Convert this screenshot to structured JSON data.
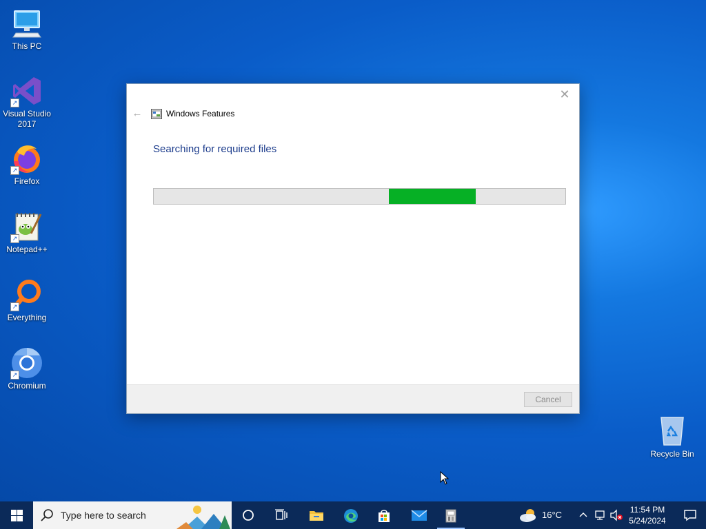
{
  "desktop": {
    "icons": [
      {
        "label": "This PC",
        "icon": "computer-icon"
      },
      {
        "label": "Visual Studio 2017",
        "icon": "visual-studio-icon"
      },
      {
        "label": "Firefox",
        "icon": "firefox-icon"
      },
      {
        "label": "Notepad++",
        "icon": "notepadpp-icon"
      },
      {
        "label": "Everything",
        "icon": "everything-search-icon"
      },
      {
        "label": "Chromium",
        "icon": "chromium-icon"
      },
      {
        "label": "Recycle Bin",
        "icon": "recycle-bin-icon"
      }
    ]
  },
  "dialog": {
    "title": "Windows Features",
    "heading": "Searching for required files",
    "progress": {
      "start_fraction": 0.571,
      "end_fraction": 0.783,
      "color": "#06b025"
    },
    "cancel_label": "Cancel",
    "close_icon": "close-icon",
    "back_icon": "back-arrow-icon"
  },
  "taskbar": {
    "search_placeholder": "Type here to search",
    "pinned": [
      "cortana-icon",
      "task-view-icon",
      "file-explorer-icon",
      "edge-icon",
      "store-icon",
      "mail-icon",
      "windows-features-icon"
    ],
    "weather": {
      "temperature": "16°C",
      "icon": "partly-cloudy-icon"
    },
    "tray_icons": [
      "chevron-up-icon",
      "network-icon",
      "volume-muted-icon"
    ],
    "clock": {
      "time": "11:54 PM",
      "date": "5/24/2024"
    },
    "notification_icon": "action-center-icon"
  },
  "colors": {
    "desktop_blue": "#0a5cc8",
    "taskbar": "#0b2a59",
    "heading_blue": "#1c3c8c",
    "progress_green": "#06b025"
  }
}
